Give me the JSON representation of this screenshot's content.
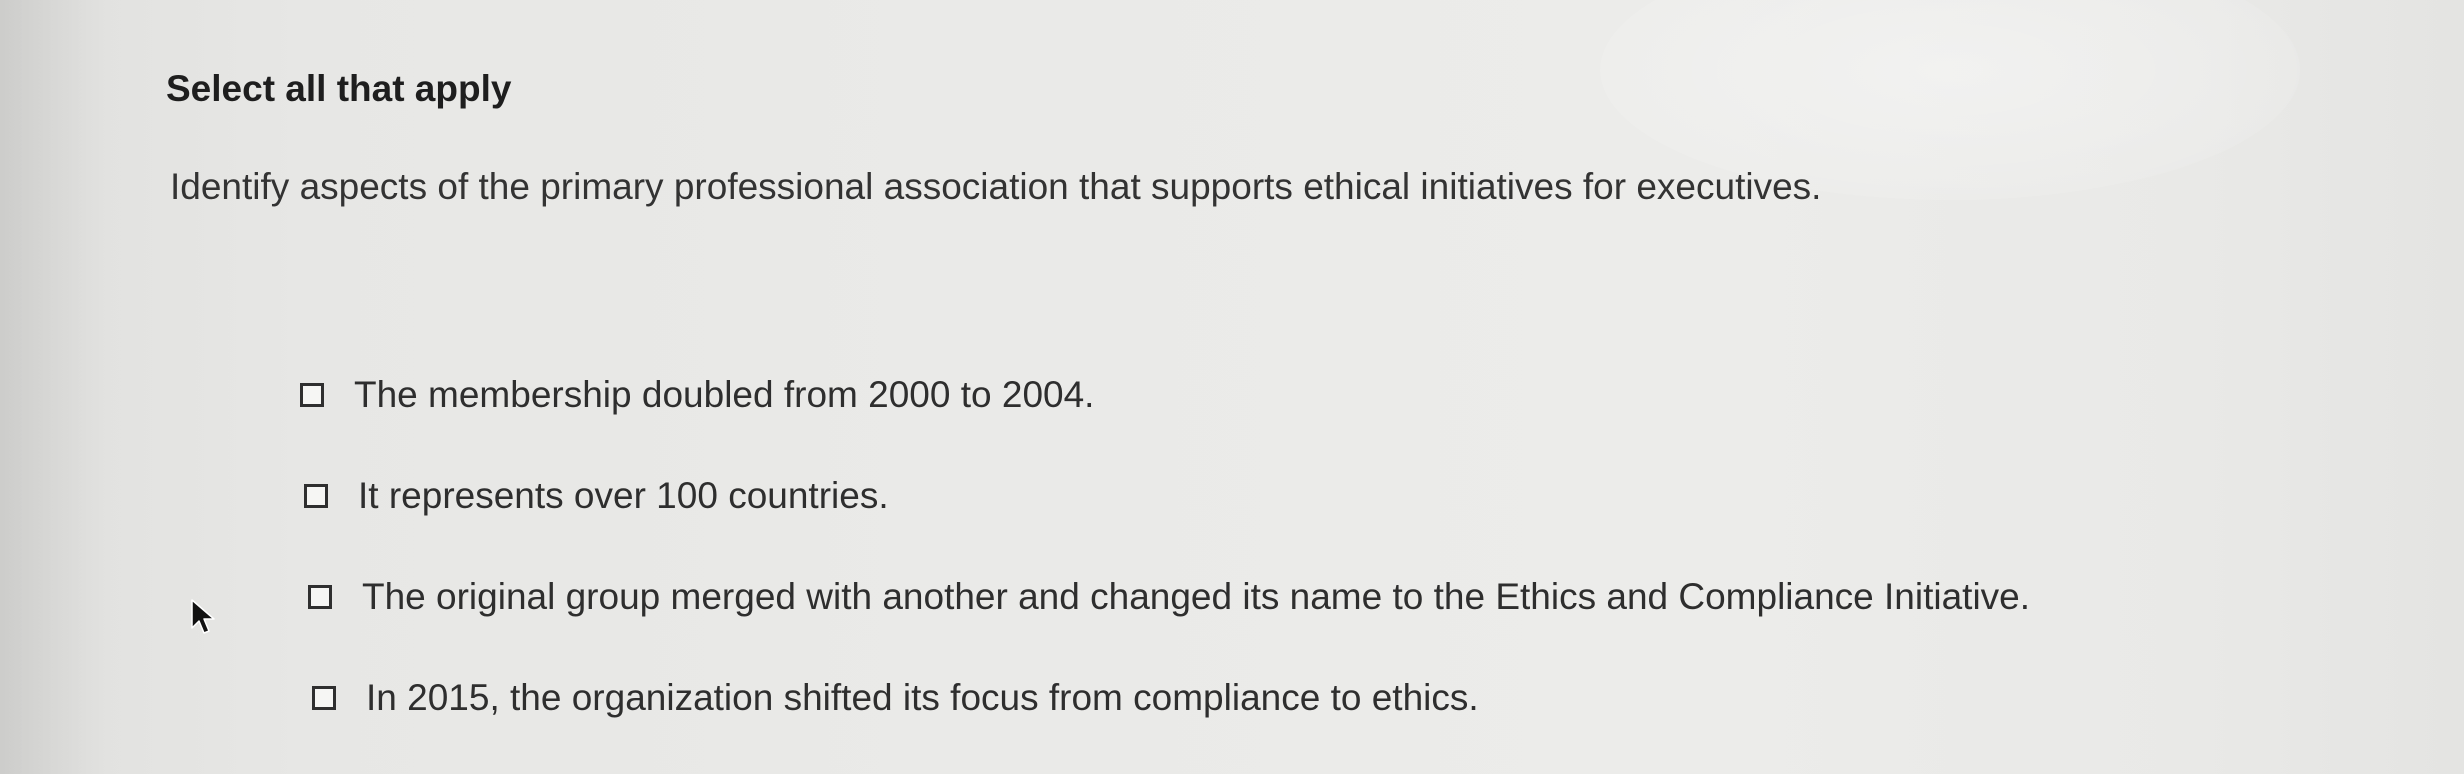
{
  "question": {
    "instruction": "Select all that apply",
    "prompt": "Identify aspects of the primary professional association that supports ethical initiatives for executives.",
    "options": [
      {
        "label": "The membership doubled from 2000 to 2004.",
        "checked": false
      },
      {
        "label": "It represents over 100 countries.",
        "checked": false
      },
      {
        "label": "The original group merged with another and changed its name to the Ethics and Compliance Initiative.",
        "checked": false
      },
      {
        "label": "In 2015, the organization shifted its focus from compliance to ethics.",
        "checked": false
      }
    ]
  },
  "icons": {
    "cursor": "mouse-pointer-icon",
    "checkbox": "checkbox-unchecked-icon"
  },
  "colors": {
    "text": "#2b2b2b",
    "background": "#eaeae8"
  }
}
